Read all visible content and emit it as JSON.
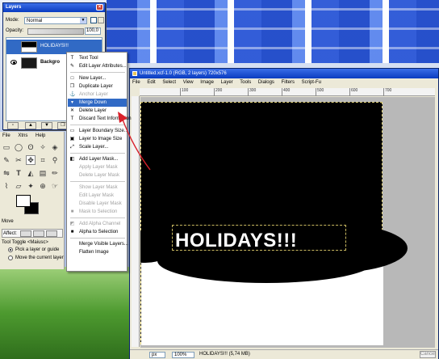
{
  "layers_dialog": {
    "title": "Layers",
    "mode_label": "Mode:",
    "mode_value": "Normal",
    "opacity_label": "Opacity:",
    "opacity_value": "100,0",
    "layers": [
      {
        "name": "HOLIDAYS!!!",
        "selected": true
      },
      {
        "name": "Backgro"
      }
    ]
  },
  "toolbox": {
    "menu": [
      "File",
      "Xtns",
      "Help"
    ],
    "tool_options_title": "Move",
    "affect_label": "Affect:",
    "tool_toggle": "Tool Toggle  <Maiusc>",
    "options": [
      "Pick a layer or guide",
      "Move the current layer"
    ]
  },
  "image_window": {
    "title": "Untitled.xcf-1.0 (RGB, 2 layers) 720x576",
    "menu": [
      "File",
      "Edit",
      "Select",
      "View",
      "Image",
      "Layer",
      "Tools",
      "Dialogs",
      "Filters",
      "Script-Fu"
    ],
    "ruler_ticks": [
      "100",
      "200",
      "300",
      "400",
      "500",
      "600",
      "700"
    ],
    "headline": "HOLIDAYS!!!",
    "status": {
      "unit": "px",
      "zoom": "100%",
      "layer_info": "HOLIDAYS!!! (5,74 MB)",
      "cancel": "Cancel"
    }
  },
  "context_menu": {
    "items": [
      {
        "label": "Text Tool",
        "enabled": true,
        "icon": "text-tool-icon",
        "icon_glyph": "T"
      },
      {
        "label": "Edit Layer Attributes...",
        "enabled": true,
        "icon": "edit-layer-icon",
        "icon_glyph": "✎"
      },
      {
        "sep": true
      },
      {
        "label": "New Layer...",
        "enabled": true,
        "icon": "new-layer-icon",
        "icon_glyph": "□"
      },
      {
        "label": "Duplicate Layer",
        "enabled": true,
        "icon": "duplicate-layer-icon",
        "icon_glyph": "❐"
      },
      {
        "label": "Anchor Layer",
        "enabled": false,
        "icon": "anchor-icon",
        "icon_glyph": "⚓"
      },
      {
        "label": "Merge Down",
        "enabled": true,
        "highlighted": true,
        "icon": "merge-down-icon",
        "icon_glyph": "▾"
      },
      {
        "label": "Delete Layer",
        "enabled": true,
        "icon": "delete-layer-icon",
        "icon_glyph": "✕"
      },
      {
        "label": "Discard Text Information",
        "enabled": true,
        "icon": "discard-text-icon",
        "icon_glyph": "T"
      },
      {
        "sep": true
      },
      {
        "label": "Layer Boundary Size...",
        "enabled": true,
        "icon": "boundary-size-icon",
        "icon_glyph": "▭"
      },
      {
        "label": "Layer to Image Size",
        "enabled": true,
        "icon": "layer-to-image-icon",
        "icon_glyph": "▣"
      },
      {
        "label": "Scale Layer...",
        "enabled": true,
        "icon": "scale-layer-icon",
        "icon_glyph": "⤢"
      },
      {
        "sep": true
      },
      {
        "label": "Add Layer Mask...",
        "enabled": true,
        "icon": "add-mask-icon",
        "icon_glyph": "◧"
      },
      {
        "label": "Apply Layer Mask",
        "enabled": false
      },
      {
        "label": "Delete Layer Mask",
        "enabled": false
      },
      {
        "sep": true
      },
      {
        "label": "Show Layer Mask",
        "enabled": false
      },
      {
        "label": "Edit Layer Mask",
        "enabled": false
      },
      {
        "label": "Disable Layer Mask",
        "enabled": false
      },
      {
        "label": "Mask to Selection",
        "enabled": false,
        "icon": "mask-selection-icon",
        "icon_glyph": "■"
      },
      {
        "sep": true
      },
      {
        "label": "Add Alpha Channel",
        "enabled": false,
        "icon": "alpha-channel-icon",
        "icon_glyph": "◩"
      },
      {
        "label": "Alpha to Selection",
        "enabled": true,
        "icon": "alpha-selection-icon",
        "icon_glyph": "■"
      },
      {
        "sep": true
      },
      {
        "label": "Merge Visible Layers...",
        "enabled": true
      },
      {
        "label": "Flatten Image",
        "enabled": true
      }
    ]
  },
  "colors": {
    "highlight": "#316ac5",
    "titlebar": "#0a3cc0",
    "annotation": "#d8202a"
  }
}
